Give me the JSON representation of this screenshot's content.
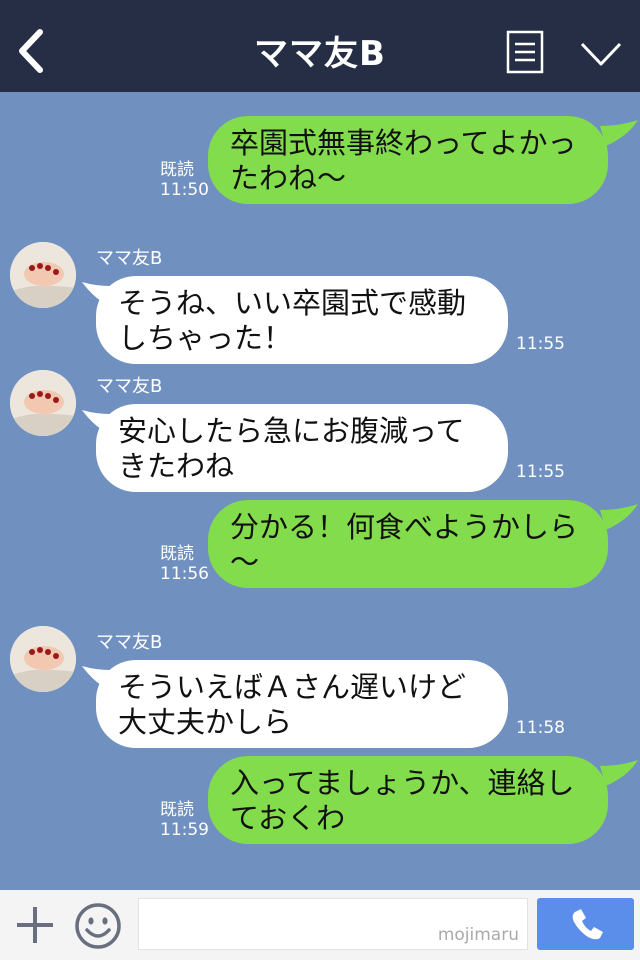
{
  "header": {
    "title": "ママ友B",
    "back_icon": "chevron-left-icon",
    "menu_icon": "notes-icon",
    "dropdown_icon": "chevron-down-icon",
    "background": "#252e45"
  },
  "colors": {
    "chat_background": "#7090c0",
    "outgoing_bubble": "#82dc4c",
    "incoming_bubble": "#ffffff",
    "send_button": "#5b8dea"
  },
  "messages": [
    {
      "from": "me",
      "text": "卒園式無事終わってよかっ\nたわね〜",
      "read_label": "既読",
      "time": "11:50"
    },
    {
      "from": "them",
      "sender": "ママ友B",
      "text": "そうね、いい卒園式で感動\nしちゃった！",
      "time": "11:55"
    },
    {
      "from": "them",
      "sender": "ママ友B",
      "text": "安心したら急にお腹減って\nきたわね",
      "time": "11:55"
    },
    {
      "from": "me",
      "text": "分かる！何食べようかしら\n〜",
      "read_label": "既読",
      "time": "11:56"
    },
    {
      "from": "them",
      "sender": "ママ友B",
      "text": "そういえばＡさん遅いけど\n大丈夫かしら",
      "time": "11:58"
    },
    {
      "from": "me",
      "text": "入ってましょうか、連絡し\nておくわ",
      "read_label": "既読",
      "time": "11:59"
    }
  ],
  "input_bar": {
    "plus_icon": "plus-icon",
    "sticker_icon": "smiley-icon",
    "placeholder": "",
    "watermark": "mojimaru",
    "send_icon": "phone-icon"
  }
}
